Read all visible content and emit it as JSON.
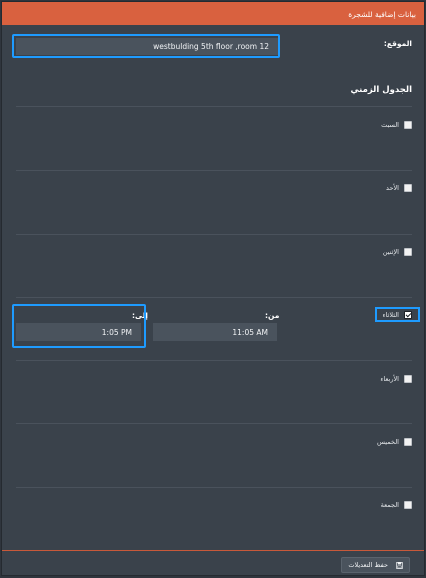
{
  "dialog": {
    "title": "بيانات إضافية للشجرة"
  },
  "location": {
    "label": "الموقع:",
    "value": "westbulding 5th floor ,room 12"
  },
  "schedule": {
    "title": "الجدول الزمني",
    "from_label": "من:",
    "to_label": "إلى:",
    "days": [
      {
        "label": "السبت",
        "checked": false
      },
      {
        "label": "الأحد",
        "checked": false
      },
      {
        "label": "الإثنين",
        "checked": false
      },
      {
        "label": "الثلاثاء",
        "checked": true,
        "from": "11:05 AM",
        "to": "1:05 PM"
      },
      {
        "label": "الأربعاء",
        "checked": false
      },
      {
        "label": "الخميس",
        "checked": false
      },
      {
        "label": "الجمعة",
        "checked": false
      }
    ]
  },
  "footer": {
    "save_label": "حفظ التعديلات",
    "save_icon": "save-icon"
  },
  "colors": {
    "header": "#d9613f",
    "highlight": "#1e9bff",
    "panel": "#3a424b",
    "input": "#4a535d"
  }
}
